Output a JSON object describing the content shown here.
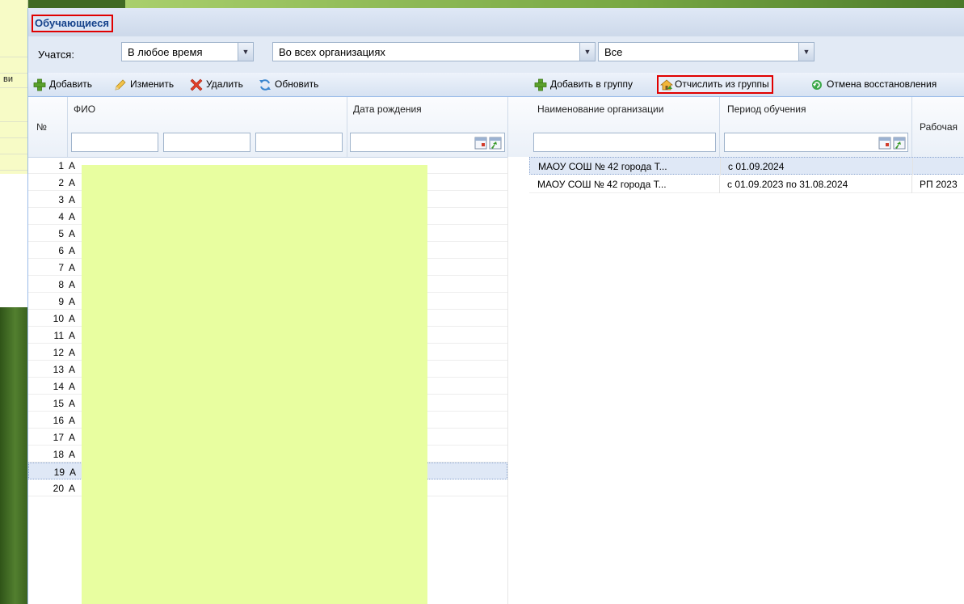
{
  "window": {
    "title": "Обучающиеся"
  },
  "background": {
    "left_fragment": "ви"
  },
  "filters": {
    "label": "Учатся:",
    "time_value": "В любое время",
    "org_value": "Во всех организациях",
    "status_value": "Все"
  },
  "left_toolbar": {
    "add": "Добавить",
    "edit": "Изменить",
    "delete": "Удалить",
    "refresh": "Обновить"
  },
  "left_grid": {
    "col_num": "№",
    "col_fio": "ФИО",
    "col_birth": "Дата рождения",
    "rows": [
      {
        "num": "1",
        "fio": "А"
      },
      {
        "num": "2",
        "fio": "А"
      },
      {
        "num": "3",
        "fio": "А"
      },
      {
        "num": "4",
        "fio": "А"
      },
      {
        "num": "5",
        "fio": "А"
      },
      {
        "num": "6",
        "fio": "А"
      },
      {
        "num": "7",
        "fio": "А"
      },
      {
        "num": "8",
        "fio": "А"
      },
      {
        "num": "9",
        "fio": "А"
      },
      {
        "num": "10",
        "fio": "А"
      },
      {
        "num": "11",
        "fio": "А"
      },
      {
        "num": "12",
        "fio": "А"
      },
      {
        "num": "13",
        "fio": "А"
      },
      {
        "num": "14",
        "fio": "А"
      },
      {
        "num": "15",
        "fio": "А"
      },
      {
        "num": "16",
        "fio": "А"
      },
      {
        "num": "17",
        "fio": "А"
      },
      {
        "num": "18",
        "fio": "А"
      },
      {
        "num": "19",
        "fio": "А"
      },
      {
        "num": "20",
        "fio": "А"
      }
    ],
    "selected_row": "19"
  },
  "right_toolbar": {
    "add_to_group": "Добавить в группу",
    "expel_from_group": "Отчислить из группы",
    "cancel_restore": "Отмена восстановления"
  },
  "right_grid": {
    "col_org": "Наименование организации",
    "col_period": "Период обучения",
    "col_work": "Рабочая",
    "rows": [
      {
        "org": "МАОУ СОШ № 42 города Т...",
        "period": "с 01.09.2024",
        "work": ""
      },
      {
        "org": "МАОУ СОШ № 42 города Т...",
        "period": "с 01.09.2023 по 31.08.2024",
        "work": "РП 2023"
      }
    ]
  },
  "colors": {
    "highlight": "#e00000",
    "header_text": "#15428b",
    "mask": "#e8fea0"
  }
}
